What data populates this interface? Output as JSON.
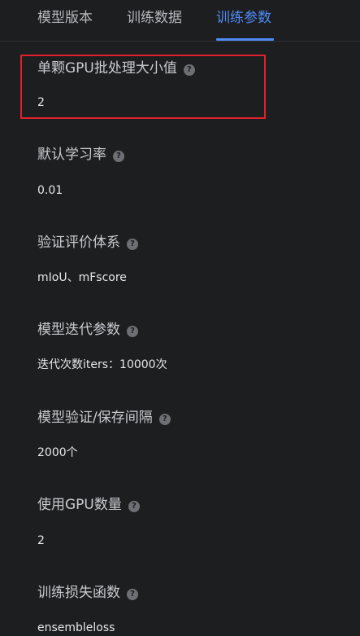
{
  "tabs": [
    {
      "label": "模型版本",
      "active": false
    },
    {
      "label": "训练数据",
      "active": false
    },
    {
      "label": "训练参数",
      "active": true
    }
  ],
  "help_icon_glyph": "?",
  "fields": [
    {
      "label": "单颗GPU批处理大小值",
      "value": "2",
      "highlighted": true
    },
    {
      "label": "默认学习率",
      "value": "0.01"
    },
    {
      "label": "验证评价体系",
      "value": "mIoU、mFscore"
    },
    {
      "label": "模型迭代参数",
      "value": "迭代次数iters：10000次"
    },
    {
      "label": "模型验证/保存间隔",
      "value": "2000个"
    },
    {
      "label": "使用GPU数量",
      "value": "2"
    },
    {
      "label": "训练损失函数",
      "value": "ensembleloss"
    }
  ],
  "colors": {
    "background": "#1d1e20",
    "accent": "#4f8bf5",
    "highlight": "#e0212b"
  }
}
